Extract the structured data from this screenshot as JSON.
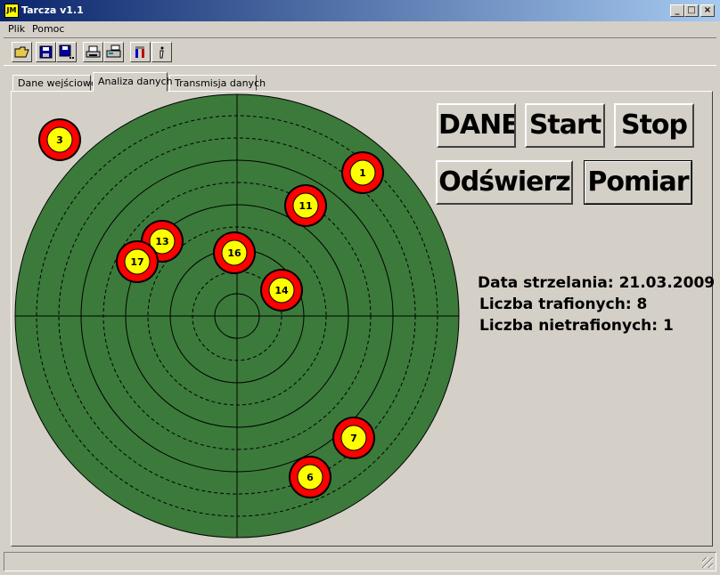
{
  "window": {
    "title": "Tarcza v1.1",
    "icon_text": "JM",
    "minimize": "_",
    "maximize": "□",
    "close": "×"
  },
  "menu": [
    "Plik",
    "Pomoc"
  ],
  "toolbar": {
    "buttons": [
      "open-icon",
      "save-icon",
      "save-as-icon",
      "print-icon",
      "printer-setup-icon",
      "tool-icon",
      "info-icon"
    ]
  },
  "tabs": [
    {
      "label": "Dane wejściowe",
      "active": false
    },
    {
      "label": "Analiza danych",
      "active": true
    },
    {
      "label": "Transmisja danych",
      "active": false
    }
  ],
  "buttons": {
    "dane": "DANE",
    "start": "Start",
    "stop": "Stop",
    "odswierz": "Odświerz",
    "pomiar": "Pomiar"
  },
  "info": {
    "date_line": "Data strzelania: 21.03.2009",
    "hits_line": "Liczba trafionych: 8",
    "misses_line": "Liczba nietrafionych: 1"
  },
  "target": {
    "field_color": "#3b7a3b",
    "marker_ring_color": "#ff0000",
    "marker_center_color": "#ffff00",
    "shots": [
      {
        "label": "3"
      },
      {
        "label": "1"
      },
      {
        "label": "11"
      },
      {
        "label": "13"
      },
      {
        "label": "17"
      },
      {
        "label": "16"
      },
      {
        "label": "14"
      },
      {
        "label": "7"
      },
      {
        "label": "6"
      }
    ]
  }
}
